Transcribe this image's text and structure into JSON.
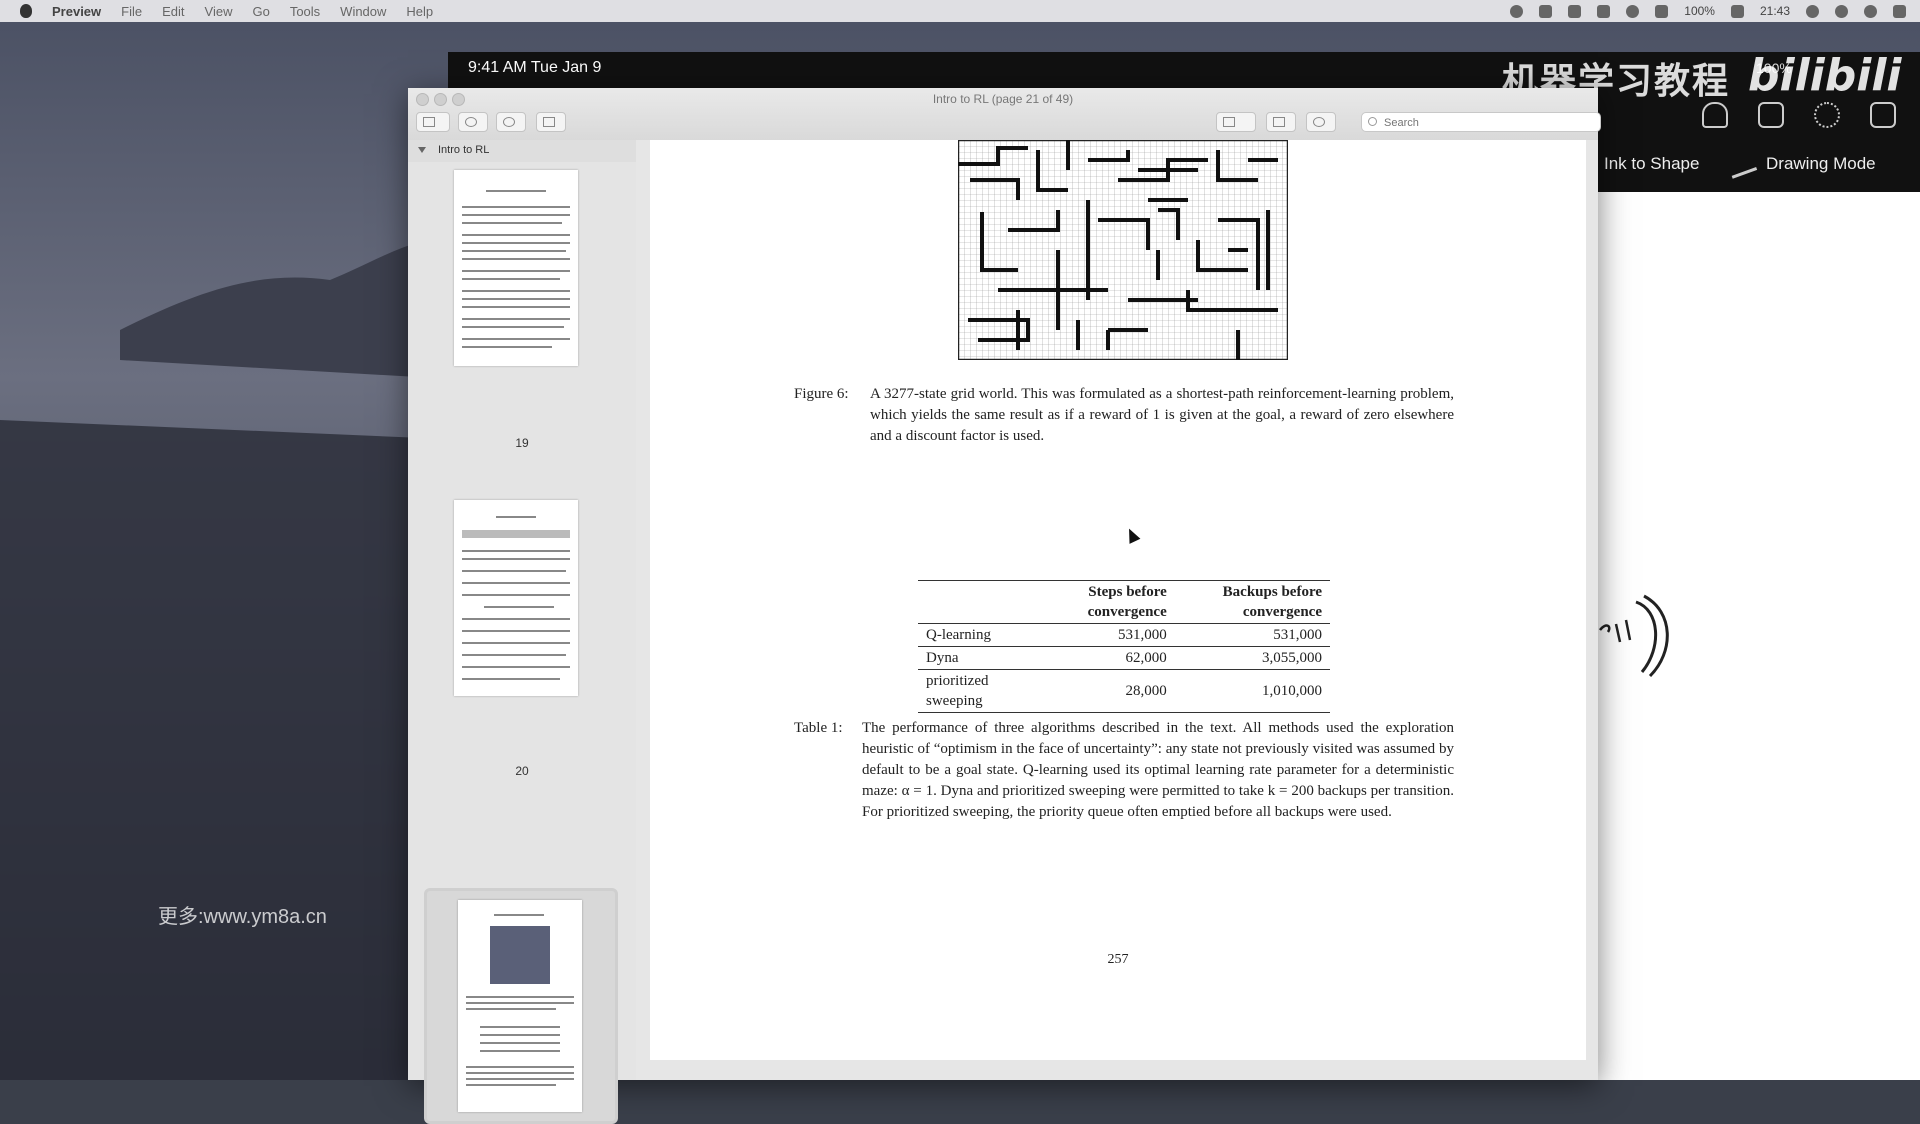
{
  "menubar": {
    "app": "Preview",
    "menus": [
      "File",
      "Edit",
      "View",
      "Go",
      "Tools",
      "Window",
      "Help"
    ],
    "battery": "100%",
    "clock": "21:43"
  },
  "sidecar": {
    "time": "9:41 AM  Tue Jan 9",
    "battery": "100%"
  },
  "watermark": {
    "chinese": "机器学习教程",
    "logo": "bilibili",
    "site": "更多:www.ym8a.cn"
  },
  "right_panel": {
    "ink_to_shape": "Ink to Shape",
    "drawing_mode": "Drawing Mode"
  },
  "window": {
    "title": "Intro to RL (page 21 of 49)",
    "search_placeholder": "Search"
  },
  "sidebar": {
    "document_name": "Intro to RL",
    "thumbnails": [
      {
        "page": "19"
      },
      {
        "page": "20"
      },
      {
        "page": "21",
        "selected": true
      }
    ]
  },
  "page": {
    "figure_label": "Figure 6:",
    "figure_caption": "A 3277-state grid world. This was formulated as a shortest-path reinforcement-learning problem, which yields the same result as if a reward of 1 is given at the goal, a reward of zero elsewhere and a discount factor is used.",
    "table": {
      "headers": [
        "",
        "Steps before convergence",
        "Backups before convergence"
      ],
      "rows": [
        [
          "Q-learning",
          "531,000",
          "531,000"
        ],
        [
          "Dyna",
          "62,000",
          "3,055,000"
        ],
        [
          "prioritized sweeping",
          "28,000",
          "1,010,000"
        ]
      ]
    },
    "table_label": "Table 1:",
    "table_caption": "The performance of three algorithms described in the text. All methods used the exploration heuristic of “optimism in the face of uncertainty”: any state not previously visited was assumed by default to be a goal state. Q-learning used its optimal learning rate parameter for a deterministic maze: α = 1. Dyna and prioritized sweeping were permitted to take k = 200 backups per transition. For prioritized sweeping, the priority queue often emptied before all backups were used.",
    "page_number": "257"
  },
  "colors": {
    "ipad_panel": "#111111",
    "page": "#ffffff",
    "window_chrome": "#e9e9e9"
  }
}
